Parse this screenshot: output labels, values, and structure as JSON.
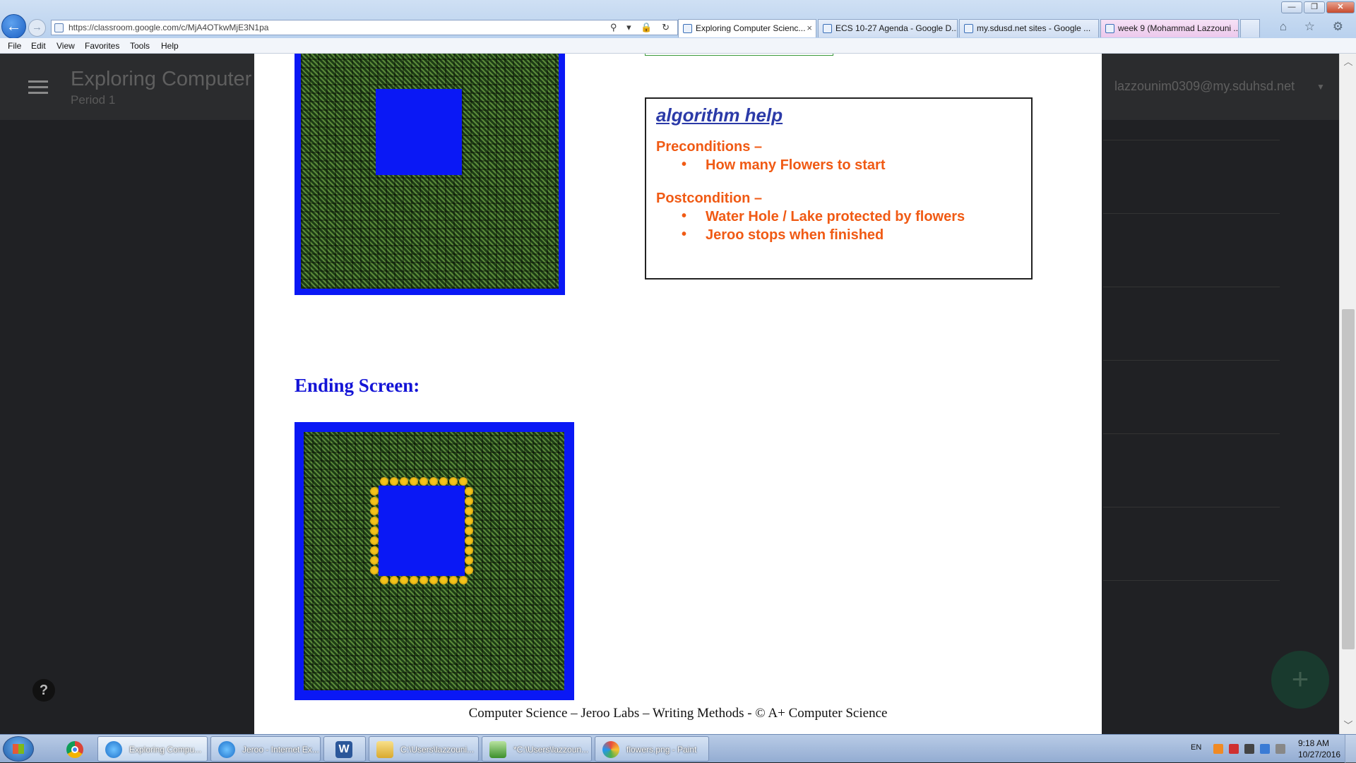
{
  "browser": {
    "url": "https://classroom.google.com/c/MjA4OTkwMjE3N1pa",
    "tabs": [
      {
        "label": "Exploring Computer Scienc...",
        "active": true
      },
      {
        "label": "ECS 10-27 Agenda - Google D..."
      },
      {
        "label": "my.sdusd.net sites - Google ..."
      },
      {
        "label": "week 9 (Mohammad Lazzouni ..."
      }
    ],
    "menu": [
      "File",
      "Edit",
      "View",
      "Favorites",
      "Tools",
      "Help"
    ],
    "window_controls": {
      "minimize": "—",
      "restore": "❐",
      "close": "✕"
    },
    "address_icons": "⚲ ▾ 🔒 ↻",
    "right_icons": "⌂ ☆ ⚙"
  },
  "classroom": {
    "course_title": "Exploring Computer",
    "section": "Period 1",
    "account": "lazzounim0309@my.sduhsd.net",
    "help": "?",
    "fab": "+"
  },
  "doc": {
    "algorithm_help": {
      "title": "algorithm help",
      "preconditions_heading": "Preconditions –",
      "preconditions": [
        "How many Flowers to start"
      ],
      "postcondition_heading": "Postcondition –",
      "postconditions": [
        "Water Hole / Lake protected by flowers",
        "Jeroo stops when finished"
      ]
    },
    "ending_heading": "Ending Screen:",
    "footer": "Computer Science – Jeroo Labs – Writing Methods - © A+ Computer Science"
  },
  "taskbar": {
    "items": [
      {
        "label": "Exploring Compu..."
      },
      {
        "label": "Jeroo - Internet Ex..."
      },
      {
        "label": "W"
      },
      {
        "label": "C:\\Users\\lazzouni..."
      },
      {
        "label": "*C:\\Users\\lazzoun..."
      },
      {
        "label": "flowers.png - Paint"
      }
    ],
    "language": "EN",
    "time": "9:18 AM",
    "date": "10/27/2016"
  },
  "colors": {
    "lake_blue": "#0a18f5",
    "accent_orange": "#f05a14",
    "heading_blue": "#1414d6",
    "algo_title_blue": "#2b3aa8"
  }
}
